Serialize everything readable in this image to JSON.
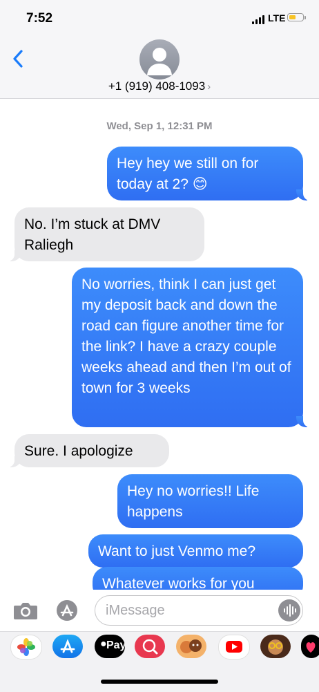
{
  "status_bar": {
    "time": "7:52",
    "network": "LTE",
    "battery_color": "#f7c325"
  },
  "header": {
    "contact": "+1 (919) 408-1093",
    "chevron": "›"
  },
  "conversation": {
    "timestamp": "Wed, Sep 1, 12:31 PM",
    "messages": [
      {
        "direction": "outgoing",
        "text": "Hey hey we still on for today at 2? 😊"
      },
      {
        "direction": "incoming",
        "text": "No. I’m stuck at DMV Raliegh"
      },
      {
        "direction": "outgoing",
        "text": "No worries, think I can just get my deposit back and down the road can figure another time for the link? I have a crazy couple weeks ahead and then I’m out of town for 3 weeks"
      },
      {
        "direction": "incoming",
        "text": "Sure. I apologize"
      },
      {
        "direction": "outgoing",
        "text": "Hey no worries!! Life happens"
      },
      {
        "direction": "outgoing",
        "text": "Want to just Venmo me?"
      },
      {
        "direction": "outgoing",
        "text": "Whatever works for you"
      }
    ]
  },
  "compose": {
    "placeholder": "iMessage"
  },
  "app_drawer": {
    "apps": [
      {
        "icon": "photos-icon"
      },
      {
        "icon": "app-store-icon"
      },
      {
        "icon": "apple-pay-icon",
        "label": "Pay"
      },
      {
        "icon": "image-search-icon"
      },
      {
        "icon": "memoji-stickers-icon"
      },
      {
        "icon": "youtube-icon"
      },
      {
        "icon": "memoji-icon"
      },
      {
        "icon": "digital-touch-icon"
      }
    ]
  },
  "colors": {
    "outgoing": "#3478f6",
    "incoming": "#e9e9eb",
    "accent": "#1a7cfb"
  }
}
